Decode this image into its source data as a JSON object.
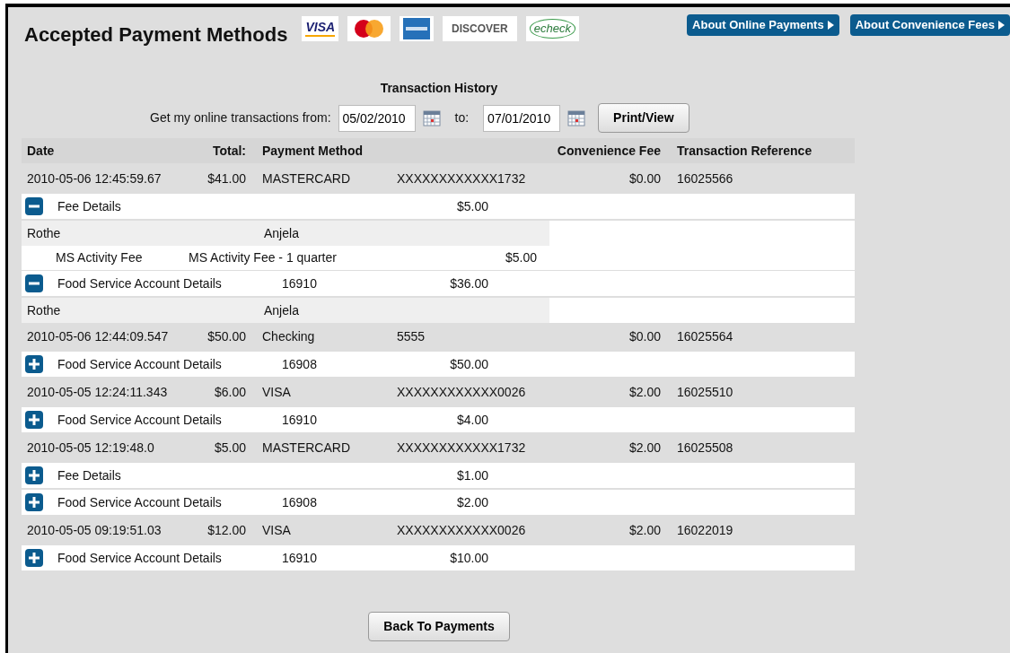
{
  "title": "Accepted Payment Methods",
  "logos": [
    {
      "kind": "visa",
      "text": "VISA"
    },
    {
      "kind": "mastercard"
    },
    {
      "kind": "amex"
    },
    {
      "kind": "discover",
      "text": "DISCOVER"
    },
    {
      "kind": "echeck",
      "text": "echeck"
    }
  ],
  "links": [
    "About Online Payments",
    "About Convenience Fees"
  ],
  "history": {
    "heading": "Transaction History",
    "from_label": "Get my online transactions from:",
    "from": "05/02/2010",
    "to_label": "to:",
    "to": "07/01/2010",
    "button": "Print/View"
  },
  "columns": [
    "Date",
    "Total:",
    "Payment Method",
    "Convenience Fee",
    "Transaction Reference"
  ],
  "transactions": [
    {
      "date": "2010-05-06 12:45:59.67",
      "total": "$41.00",
      "method": "MASTERCARD",
      "account": "XXXXXXXXXXXX1732",
      "fee": "$0.00",
      "reference": "16025566",
      "details": [
        {
          "kind": "fee",
          "label": "Fee Details",
          "amount": "$5.00",
          "expanded": true,
          "children": [
            {
              "kind": "name",
              "last": "Rothe",
              "first": "Anjela"
            },
            {
              "kind": "item",
              "name": "MS Activity Fee",
              "description": "MS Activity Fee - 1 quarter",
              "amount": "$5.00"
            }
          ]
        },
        {
          "kind": "food",
          "label": "Food Service Account Details",
          "account": "16910",
          "amount": "$36.00",
          "expanded": true,
          "children": [
            {
              "kind": "name",
              "last": "Rothe",
              "first": "Anjela"
            }
          ]
        }
      ]
    },
    {
      "date": "2010-05-06 12:44:09.547",
      "total": "$50.00",
      "method": "Checking",
      "account": "5555",
      "fee": "$0.00",
      "reference": "16025564",
      "details": [
        {
          "kind": "food",
          "label": "Food Service Account Details",
          "account": "16908",
          "amount": "$50.00",
          "expanded": false
        }
      ]
    },
    {
      "date": "2010-05-05 12:24:11.343",
      "total": "$6.00",
      "method": "VISA",
      "account": "XXXXXXXXXXXX0026",
      "fee": "$2.00",
      "reference": "16025510",
      "details": [
        {
          "kind": "food",
          "label": "Food Service Account Details",
          "account": "16910",
          "amount": "$4.00",
          "expanded": false
        }
      ]
    },
    {
      "date": "2010-05-05 12:19:48.0",
      "total": "$5.00",
      "method": "MASTERCARD",
      "account": "XXXXXXXXXXXX1732",
      "fee": "$2.00",
      "reference": "16025508",
      "details": [
        {
          "kind": "fee",
          "label": "Fee Details",
          "amount": "$1.00",
          "expanded": false
        },
        {
          "kind": "food",
          "label": "Food Service Account Details",
          "account": "16908",
          "amount": "$2.00",
          "expanded": false
        }
      ]
    },
    {
      "date": "2010-05-05 09:19:51.03",
      "total": "$12.00",
      "method": "VISA",
      "account": "XXXXXXXXXXXX0026",
      "fee": "$2.00",
      "reference": "16022019",
      "details": [
        {
          "kind": "food",
          "label": "Food Service Account Details",
          "account": "16910",
          "amount": "$10.00",
          "expanded": false
        }
      ]
    }
  ],
  "back_button": "Back To Payments"
}
